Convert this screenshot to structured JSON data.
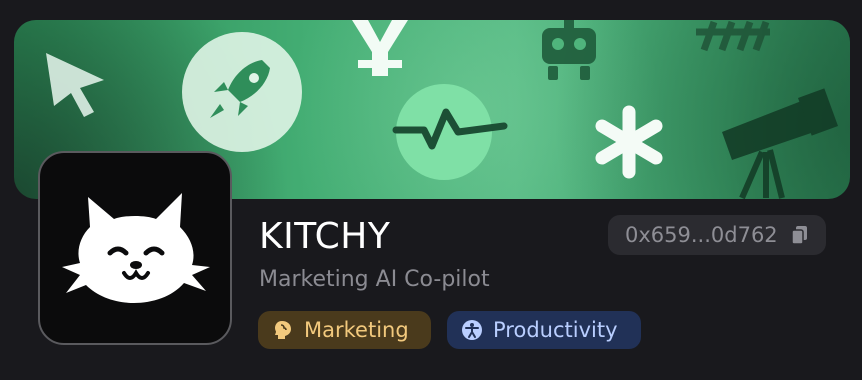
{
  "app": {
    "name": "KITCHY",
    "subtitle": "Marketing AI Co-pilot",
    "address": "0x659...0d762"
  },
  "tags": [
    {
      "label": "Marketing",
      "icon": "head-icon",
      "color": "#f2c97d",
      "background": "#4a3a1c"
    },
    {
      "label": "Productivity",
      "icon": "accessibility-icon",
      "color": "#b9ceff",
      "background": "#213157"
    }
  ],
  "banner": {
    "icons": [
      "cursor-icon",
      "rocket-icon",
      "yen-icon",
      "robot-icon",
      "hashtag-icon",
      "activity-icon",
      "asterisk-icon",
      "telescope-icon"
    ],
    "accent": "#4fb57c"
  },
  "avatar": {
    "icon": "cat-face-icon"
  },
  "colors": {
    "page_background": "#19191d",
    "title": "#ffffff",
    "subtitle": "#8b8b92"
  }
}
